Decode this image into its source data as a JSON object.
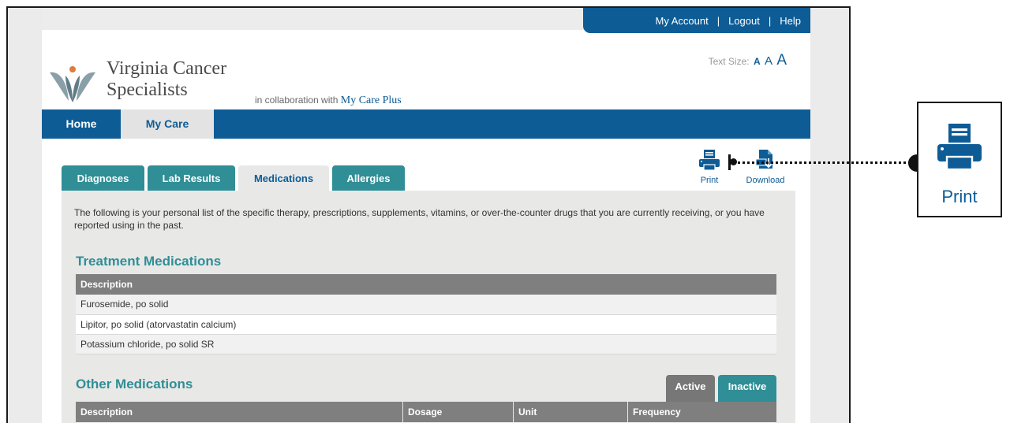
{
  "colors": {
    "brand_blue": "#0d5c96",
    "teal": "#2f8e96",
    "table_header": "#7f7f7f"
  },
  "account": {
    "my_account": "My Account",
    "logout": "Logout",
    "help": "Help",
    "sep": "|"
  },
  "logo": {
    "line1": "Virginia Cancer",
    "line2": "Specialists",
    "icon": "vcs-leaf-logo"
  },
  "collab": {
    "prefix": "in collaboration with",
    "brand": "My Care Plus"
  },
  "text_size": {
    "label": "Text Size:",
    "small": "A",
    "medium": "A",
    "large": "A"
  },
  "nav": {
    "home": "Home",
    "my_care": "My Care"
  },
  "actions": {
    "print": "Print",
    "download": "Download",
    "print_icon": "printer-icon",
    "download_icon": "download-document-icon"
  },
  "tabs": {
    "diagnoses": "Diagnoses",
    "lab_results": "Lab Results",
    "medications": "Medications",
    "allergies": "Allergies",
    "active": "Medications"
  },
  "intro": "The following is your personal list of the specific therapy, prescriptions, supplements, vitamins, or over-the-counter drugs that you are currently receiving, or you have reported using in the past.",
  "treatment": {
    "title": "Treatment Medications",
    "column": "Description",
    "rows": [
      "Furosemide, po solid",
      "Lipitor, po solid (atorvastatin calcium)",
      "Potassium chloride, po solid SR"
    ]
  },
  "other": {
    "title": "Other Medications",
    "status_active": "Active",
    "status_inactive": "Inactive",
    "columns": {
      "description": "Description",
      "dosage": "Dosage",
      "unit": "Unit",
      "frequency": "Frequency"
    }
  },
  "callout": {
    "label": "Print",
    "icon": "printer-icon"
  }
}
